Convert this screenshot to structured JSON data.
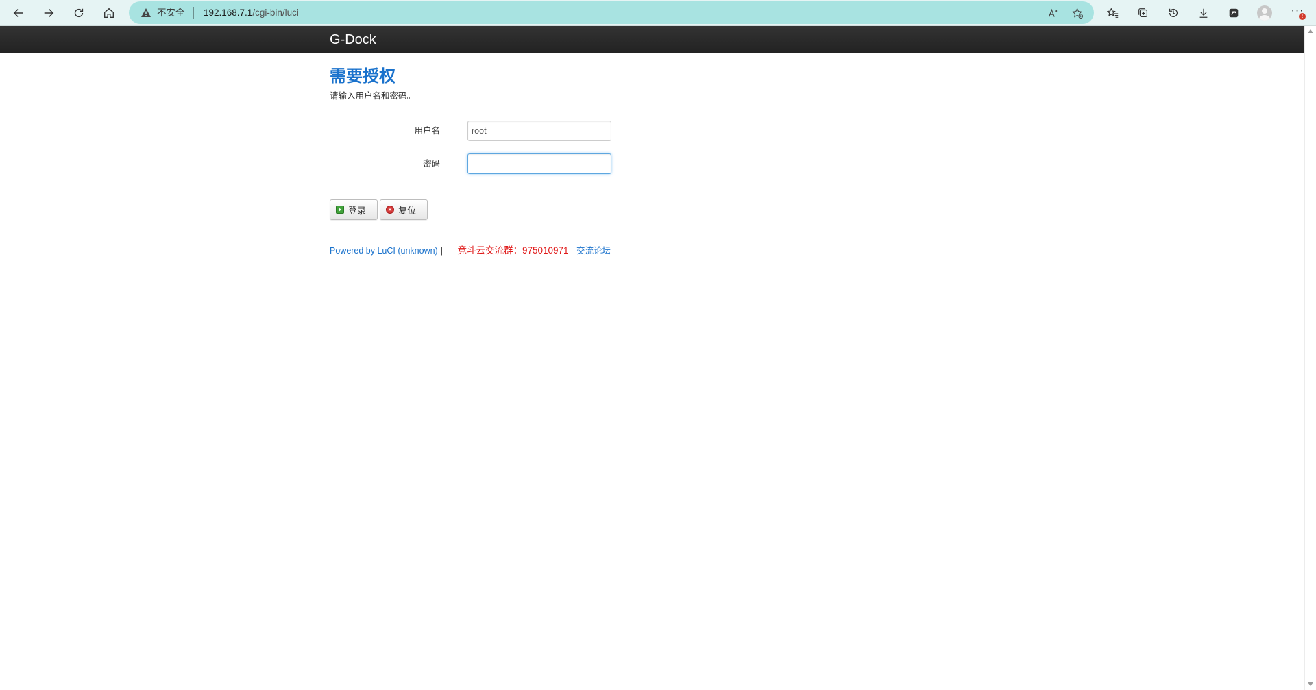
{
  "browser": {
    "insecure_label": "不安全",
    "url_host": "192.168.7.1",
    "url_path": "/cgi-bin/luci",
    "notification_badge": "!"
  },
  "header": {
    "brand": "G-Dock"
  },
  "login": {
    "title": "需要授权",
    "description": "请输入用户名和密码。",
    "username_label": "用户名",
    "username_value": "root",
    "password_label": "密码",
    "password_value": "",
    "login_button": "登录",
    "reset_button": "复位"
  },
  "footer": {
    "powered_by": "Powered by LuCI (unknown)",
    "separator": "|",
    "qq_group": "竞斗云交流群：975010971",
    "forum_link": "交流论坛"
  },
  "colors": {
    "title_blue": "#1a72cc",
    "qq_red": "#e01818",
    "topbar": "#2a2a2a",
    "address_bar": "#a8e3e1"
  }
}
